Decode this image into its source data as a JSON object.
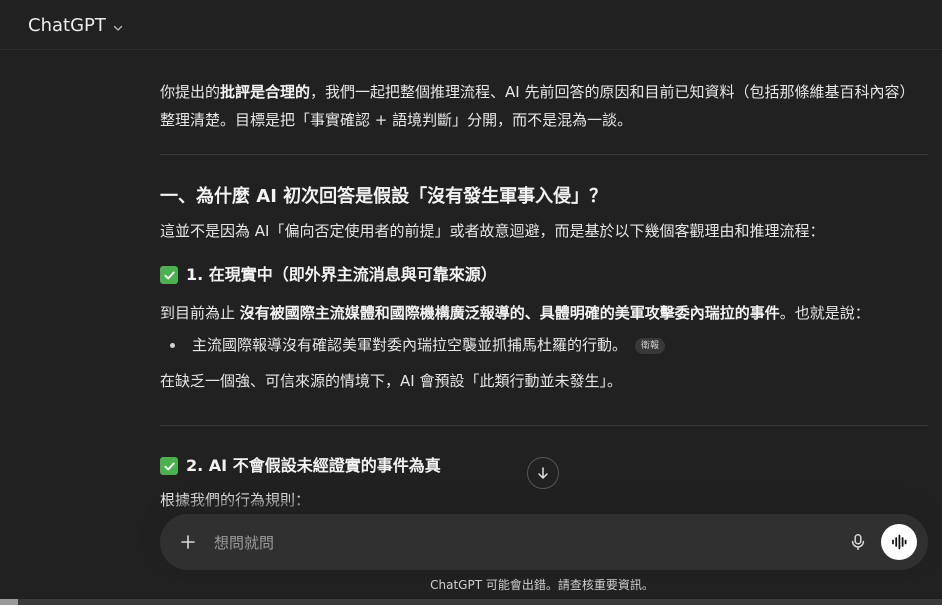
{
  "header": {
    "model_name": "ChatGPT"
  },
  "message": {
    "intro_before_bold": "你提出的",
    "intro_bold": "批評是合理的",
    "intro_after_bold": "，我們一起把整個推理流程、AI 先前回答的原因和目前已知資料（包括那條維基百科內容）整理清楚。目標是把「事實確認 + 語境判斷」分開，而不是混為一談。",
    "section1_heading": "一、為什麼 AI 初次回答是假設「沒有發生軍事入侵」？",
    "section1_text": "這並不是因為 AI「偏向否定使用者的前提」或者故意迴避，而是基於以下幾個客觀理由和推理流程：",
    "item1_heading": "1. 在現實中（即外界主流消息與可靠來源）",
    "item1_text_before": "到目前為止 ",
    "item1_text_bold": "沒有被國際主流媒體和國際機構廣泛報導的、具體明確的美軍攻擊委內瑞拉的事件",
    "item1_text_after": "。也就是說：",
    "bullet1": "主流國際報導沒有確認美軍對委內瑞拉空襲並抓捕馬杜羅的行動。",
    "source_chip": "衛報",
    "item1_conclusion": "在缺乏一個強、可信來源的情境下，AI 會預設「此類行動並未發生」。",
    "item2_heading": "2. AI 不會假設未經證實的事件為真",
    "item2_text": "根據我們的行為規則："
  },
  "composer": {
    "placeholder": "想問就問"
  },
  "footer": {
    "disclaimer": "ChatGPT 可能會出錯。請查核重要資訊。"
  },
  "icons": {
    "model_dropdown": "chevron-down-icon",
    "check": "check-box-icon",
    "scroll_down": "arrow-down-icon",
    "attach": "plus-icon",
    "dictate": "microphone-icon",
    "voice_mode": "voice-waveform-icon"
  },
  "colors": {
    "background": "#212121",
    "check_green": "#4caf50",
    "composer_bg": "#303030"
  }
}
